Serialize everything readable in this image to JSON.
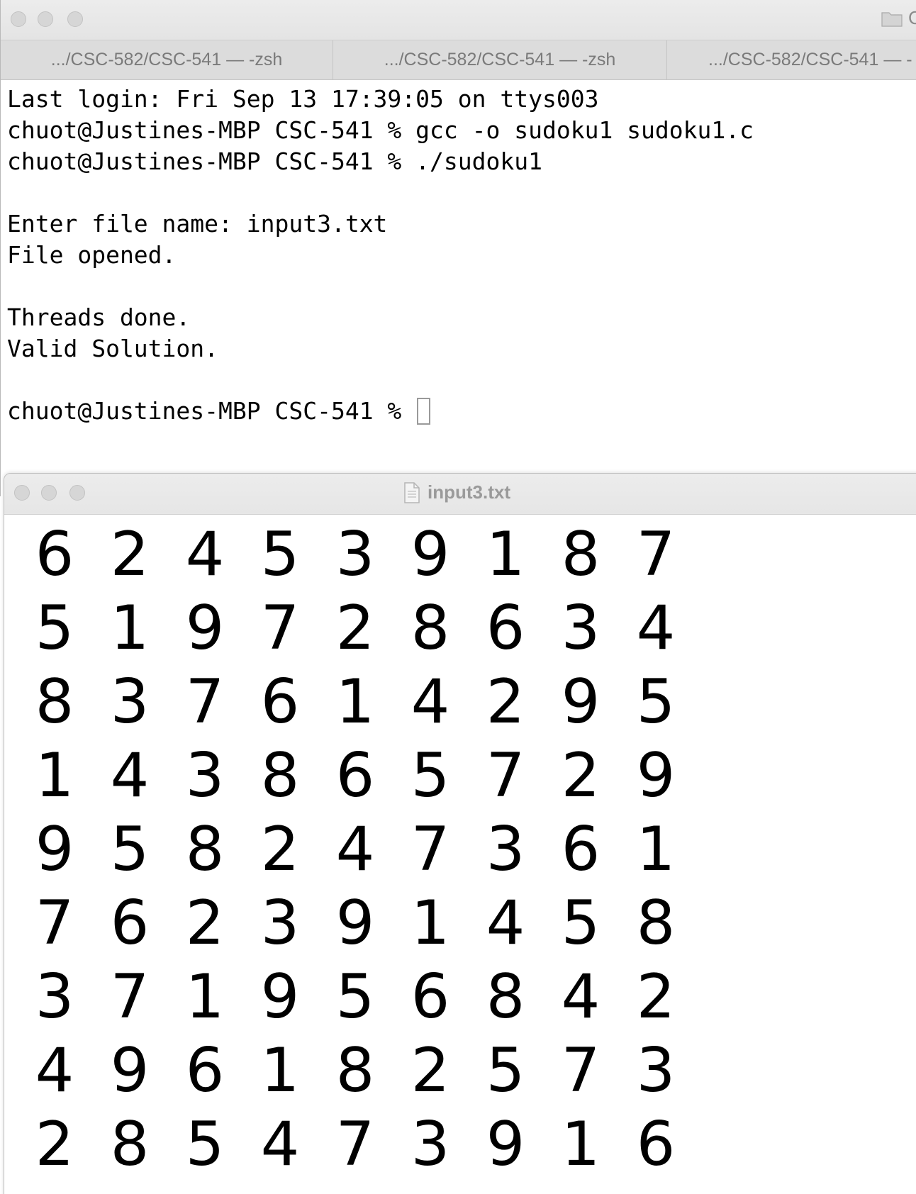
{
  "terminal": {
    "tabs": [
      ".../CSC-582/CSC-541 — -zsh",
      ".../CSC-582/CSC-541 — -zsh",
      ".../CSC-582/CSC-541 — -"
    ],
    "folder_label": "C",
    "lines": [
      "Last login: Fri Sep 13 17:39:05 on ttys003",
      "chuot@Justines-MBP CSC-541 % gcc -o sudoku1 sudoku1.c",
      "chuot@Justines-MBP CSC-541 % ./sudoku1",
      "",
      "Enter file name: input3.txt",
      "File opened.",
      "",
      "Threads done.",
      "Valid Solution.",
      ""
    ],
    "prompt": "chuot@Justines-MBP CSC-541 % "
  },
  "editor": {
    "title": "input3.txt",
    "grid": [
      [
        "6",
        "2",
        "4",
        "5",
        "3",
        "9",
        "1",
        "8",
        "7"
      ],
      [
        "5",
        "1",
        "9",
        "7",
        "2",
        "8",
        "6",
        "3",
        "4"
      ],
      [
        "8",
        "3",
        "7",
        "6",
        "1",
        "4",
        "2",
        "9",
        "5"
      ],
      [
        "1",
        "4",
        "3",
        "8",
        "6",
        "5",
        "7",
        "2",
        "9"
      ],
      [
        "9",
        "5",
        "8",
        "2",
        "4",
        "7",
        "3",
        "6",
        "1"
      ],
      [
        "7",
        "6",
        "2",
        "3",
        "9",
        "1",
        "4",
        "5",
        "8"
      ],
      [
        "3",
        "7",
        "1",
        "9",
        "5",
        "6",
        "8",
        "4",
        "2"
      ],
      [
        "4",
        "9",
        "6",
        "1",
        "8",
        "2",
        "5",
        "7",
        "3"
      ],
      [
        "2",
        "8",
        "5",
        "4",
        "7",
        "3",
        "9",
        "1",
        "6"
      ]
    ]
  }
}
